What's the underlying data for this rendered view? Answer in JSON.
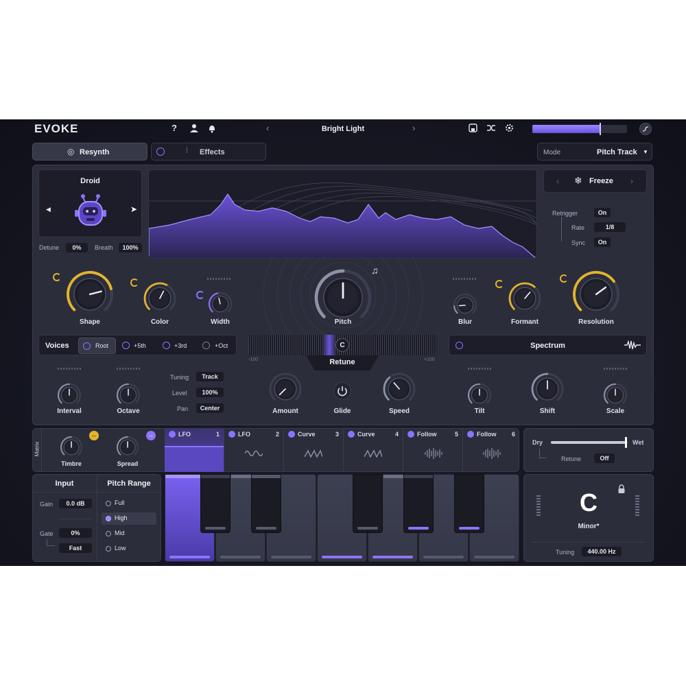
{
  "app": {
    "name": "EVOKE",
    "preset": "Bright Light"
  },
  "topbar": {
    "help": "?",
    "meter_level": 0.72
  },
  "tabs": {
    "resynth": "Resynth",
    "effects": "Effects",
    "mode_label": "Mode",
    "mode_value": "Pitch Track"
  },
  "voice": {
    "name": "Droid",
    "detune_label": "Detune",
    "detune_value": "0%",
    "breath_label": "Breath",
    "breath_value": "100%"
  },
  "freeze": {
    "label": "Freeze",
    "retrigger_label": "Retrigger",
    "retrigger_value": "On",
    "rate_label": "Rate",
    "rate_value": "1/8",
    "sync_label": "Sync",
    "sync_value": "On"
  },
  "knobs": {
    "shape": {
      "label": "Shape",
      "value": 0.78
    },
    "color": {
      "label": "Color",
      "value": 0.6
    },
    "width": {
      "label": "Width",
      "value": 0.45
    },
    "pitch": {
      "label": "Pitch",
      "value": 0.5
    },
    "blur": {
      "label": "Blur",
      "value": 0.15
    },
    "formant": {
      "label": "Formant",
      "value": 0.65
    },
    "resolution": {
      "label": "Resolution",
      "value": 0.7
    }
  },
  "voices": {
    "title": "Voices",
    "root": "Root",
    "fifth": "+5th",
    "third": "+3rd",
    "oct": "+Oct",
    "interval": "Interval",
    "octave": "Octave",
    "tuning_label": "Tuning",
    "tuning_value": "Track",
    "level_label": "Level",
    "level_value": "100%",
    "pan_label": "Pan",
    "pan_value": "Center"
  },
  "retune": {
    "note": "C",
    "label": "Retune",
    "min": "-100",
    "max": "+100",
    "amount": "Amount",
    "glide": "Glide",
    "speed": "Speed"
  },
  "spectrum": {
    "title": "Spectrum",
    "tilt": "Tilt",
    "shift": "Shift",
    "scale": "Scale"
  },
  "matrix": {
    "label": "Matrix",
    "timbre": "Timbre",
    "spread": "Spread",
    "slots": [
      {
        "name": "LFO",
        "num": "1"
      },
      {
        "name": "LFO",
        "num": "2"
      },
      {
        "name": "Curve",
        "num": "3"
      },
      {
        "name": "Curve",
        "num": "4"
      },
      {
        "name": "Follow",
        "num": "5"
      },
      {
        "name": "Follow",
        "num": "6"
      }
    ]
  },
  "mix": {
    "dry": "Dry",
    "wet": "Wet",
    "retune_label": "Retune",
    "retune_value": "Off",
    "value": 0.97
  },
  "input": {
    "title": "Input",
    "gain_label": "Gain",
    "gain_value": "0.0 dB",
    "gate_label": "Gate",
    "gate_value": "0%",
    "speed_value": "Fast"
  },
  "pitch_range": {
    "title": "Pitch Range",
    "options": [
      "Full",
      "High",
      "Mid",
      "Low"
    ],
    "selected": 1
  },
  "key": {
    "note": "C",
    "scale": "Minor*",
    "tuning_label": "Tuning",
    "tuning_value": "440.00 Hz"
  },
  "colors": {
    "accent": "#8c74ff",
    "gold": "#e3b42c",
    "bg": "#14151f",
    "panel": "#2b2d3b"
  }
}
